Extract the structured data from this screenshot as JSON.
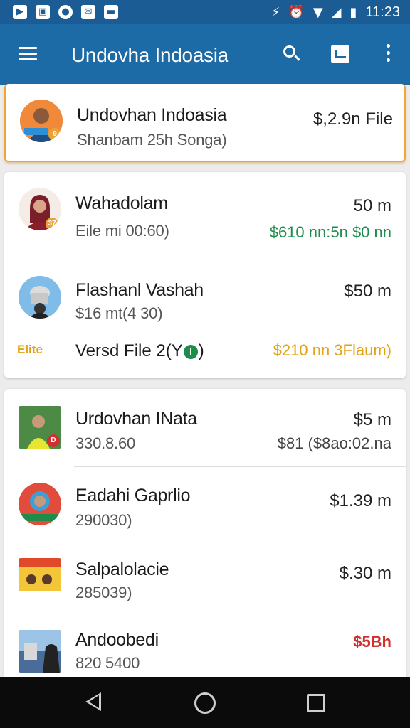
{
  "status_bar": {
    "left_icons": [
      "notification-icon",
      "gallery-icon",
      "location-pin-icon",
      "mail-icon",
      "message-icon"
    ],
    "time": "11:23"
  },
  "app_bar": {
    "title": "Undovha Indoasia"
  },
  "featured": {
    "title": "Undovhan Indoasia",
    "subtitle": "Shanbam 25h Songa)",
    "right_top": "$,2.9n File"
  },
  "group1": {
    "items": [
      {
        "title": "Wahadolam",
        "subtitle": "Eile mi 00:60)",
        "right_top": "50 m",
        "right_bottom": "$610 nn:5n $0 nn"
      },
      {
        "title": "Flashanl Vashah",
        "subtitle": "$16 mt(4 30)",
        "right_top": "$50 m",
        "right_bottom": ""
      }
    ],
    "footer": {
      "tag": "Elite",
      "label": "Versd File 2(Y",
      "label_badge": "I",
      "label_end": ")",
      "right": "$210 nn 3Flaum)"
    }
  },
  "group2": {
    "items": [
      {
        "title": "Urdovhan INata",
        "subtitle": "330.8.60",
        "right_top": "$5 m",
        "right_bottom": "$81 ($8ao:02.na"
      },
      {
        "title": "Eadahi Gaprlio",
        "subtitle": "290030)",
        "right_top": "$1.39 m",
        "right_bottom": ""
      },
      {
        "title": "Salpalolacie",
        "subtitle": "285039)",
        "right_top": "$.30 m",
        "right_bottom": ""
      },
      {
        "title": "Andoobedi",
        "subtitle": "820 5400",
        "right_top": "$5Bh",
        "right_bottom": ""
      }
    ]
  },
  "colors": {
    "status_bar": "#1a5c93",
    "app_bar": "#1c6aa6",
    "accent_orange": "#f0a43a",
    "positive_green": "#1e8c4a",
    "gold": "#e2a213",
    "alert_red": "#d32f2f"
  }
}
